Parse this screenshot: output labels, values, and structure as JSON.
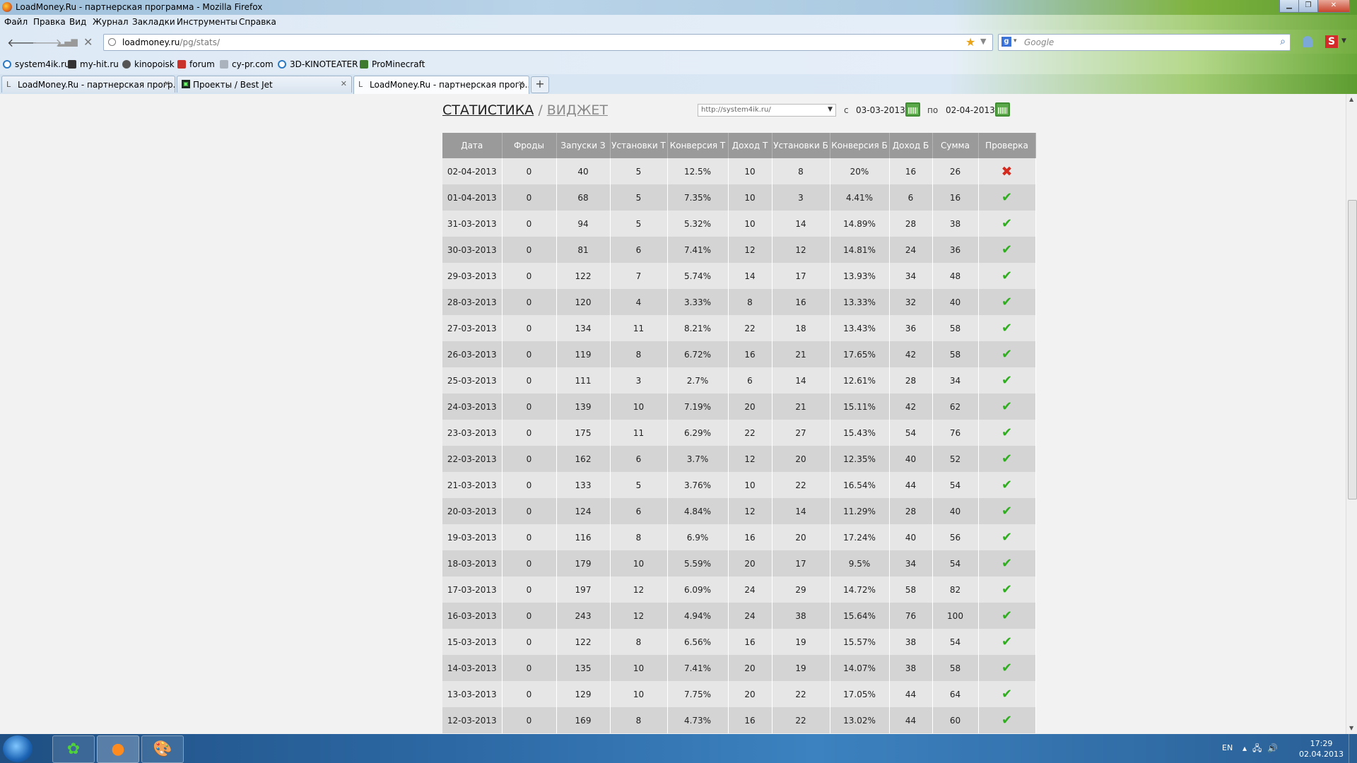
{
  "window": {
    "title": "LoadMoney.Ru - партнерская программа - Mozilla Firefox"
  },
  "menu": [
    "Файл",
    "Правка",
    "Вид",
    "Журнал",
    "Закладки",
    "Инструменты",
    "Справка"
  ],
  "address": {
    "host": "loadmoney.ru",
    "path": "/pg/stats/"
  },
  "search": {
    "placeholder": "Google"
  },
  "bookmarks": [
    "system4ik.ru",
    "my-hit.ru",
    "kinopoisk",
    "forum",
    "cy-pr.com",
    "3D-KINOTEATER",
    "ProMinecraft"
  ],
  "tabs": [
    {
      "label": "LoadMoney.Ru - партнерская прогр...",
      "active": false
    },
    {
      "label": "Проекты / Best Jet",
      "active": false
    },
    {
      "label": "LoadMoney.Ru - партнерская прогр...",
      "active": true
    }
  ],
  "page": {
    "nav_active": "СТАТИСТИКА",
    "nav_sep": "/",
    "nav_link": "ВИДЖЕТ",
    "site_value": "http://system4ik.ru/",
    "from_label": "с",
    "from_date": "03-03-2013",
    "to_label": "по",
    "to_date": "02-04-2013"
  },
  "table": {
    "columns": [
      "Дата",
      "Фроды",
      "Запуски З",
      "Установки Т",
      "Конверсия Т",
      "Доход Т",
      "Установки Б",
      "Конверсия Б",
      "Доход Б",
      "Сумма",
      "Проверка"
    ],
    "rows": [
      [
        "02-04-2013",
        "0",
        "40",
        "5",
        "12.5%",
        "10",
        "8",
        "20%",
        "16",
        "26",
        "fail"
      ],
      [
        "01-04-2013",
        "0",
        "68",
        "5",
        "7.35%",
        "10",
        "3",
        "4.41%",
        "6",
        "16",
        "ok"
      ],
      [
        "31-03-2013",
        "0",
        "94",
        "5",
        "5.32%",
        "10",
        "14",
        "14.89%",
        "28",
        "38",
        "ok"
      ],
      [
        "30-03-2013",
        "0",
        "81",
        "6",
        "7.41%",
        "12",
        "12",
        "14.81%",
        "24",
        "36",
        "ok"
      ],
      [
        "29-03-2013",
        "0",
        "122",
        "7",
        "5.74%",
        "14",
        "17",
        "13.93%",
        "34",
        "48",
        "ok"
      ],
      [
        "28-03-2013",
        "0",
        "120",
        "4",
        "3.33%",
        "8",
        "16",
        "13.33%",
        "32",
        "40",
        "ok"
      ],
      [
        "27-03-2013",
        "0",
        "134",
        "11",
        "8.21%",
        "22",
        "18",
        "13.43%",
        "36",
        "58",
        "ok"
      ],
      [
        "26-03-2013",
        "0",
        "119",
        "8",
        "6.72%",
        "16",
        "21",
        "17.65%",
        "42",
        "58",
        "ok"
      ],
      [
        "25-03-2013",
        "0",
        "111",
        "3",
        "2.7%",
        "6",
        "14",
        "12.61%",
        "28",
        "34",
        "ok"
      ],
      [
        "24-03-2013",
        "0",
        "139",
        "10",
        "7.19%",
        "20",
        "21",
        "15.11%",
        "42",
        "62",
        "ok"
      ],
      [
        "23-03-2013",
        "0",
        "175",
        "11",
        "6.29%",
        "22",
        "27",
        "15.43%",
        "54",
        "76",
        "ok"
      ],
      [
        "22-03-2013",
        "0",
        "162",
        "6",
        "3.7%",
        "12",
        "20",
        "12.35%",
        "40",
        "52",
        "ok"
      ],
      [
        "21-03-2013",
        "0",
        "133",
        "5",
        "3.76%",
        "10",
        "22",
        "16.54%",
        "44",
        "54",
        "ok"
      ],
      [
        "20-03-2013",
        "0",
        "124",
        "6",
        "4.84%",
        "12",
        "14",
        "11.29%",
        "28",
        "40",
        "ok"
      ],
      [
        "19-03-2013",
        "0",
        "116",
        "8",
        "6.9%",
        "16",
        "20",
        "17.24%",
        "40",
        "56",
        "ok"
      ],
      [
        "18-03-2013",
        "0",
        "179",
        "10",
        "5.59%",
        "20",
        "17",
        "9.5%",
        "34",
        "54",
        "ok"
      ],
      [
        "17-03-2013",
        "0",
        "197",
        "12",
        "6.09%",
        "24",
        "29",
        "14.72%",
        "58",
        "82",
        "ok"
      ],
      [
        "16-03-2013",
        "0",
        "243",
        "12",
        "4.94%",
        "24",
        "38",
        "15.64%",
        "76",
        "100",
        "ok"
      ],
      [
        "15-03-2013",
        "0",
        "122",
        "8",
        "6.56%",
        "16",
        "19",
        "15.57%",
        "38",
        "54",
        "ok"
      ],
      [
        "14-03-2013",
        "0",
        "135",
        "10",
        "7.41%",
        "20",
        "19",
        "14.07%",
        "38",
        "58",
        "ok"
      ],
      [
        "13-03-2013",
        "0",
        "129",
        "10",
        "7.75%",
        "20",
        "22",
        "17.05%",
        "44",
        "64",
        "ok"
      ],
      [
        "12-03-2013",
        "0",
        "169",
        "8",
        "4.73%",
        "16",
        "22",
        "13.02%",
        "44",
        "60",
        "ok"
      ]
    ]
  },
  "taskbar": {
    "lang": "EN",
    "time": "17:29",
    "date": "02.04.2013"
  },
  "colors": {
    "header_bg": "#9a9a9a",
    "row_odd": "#e6e6e6",
    "row_even": "#d4d4d4",
    "check_ok": "#2fae1f",
    "check_fail": "#d52b1e"
  }
}
